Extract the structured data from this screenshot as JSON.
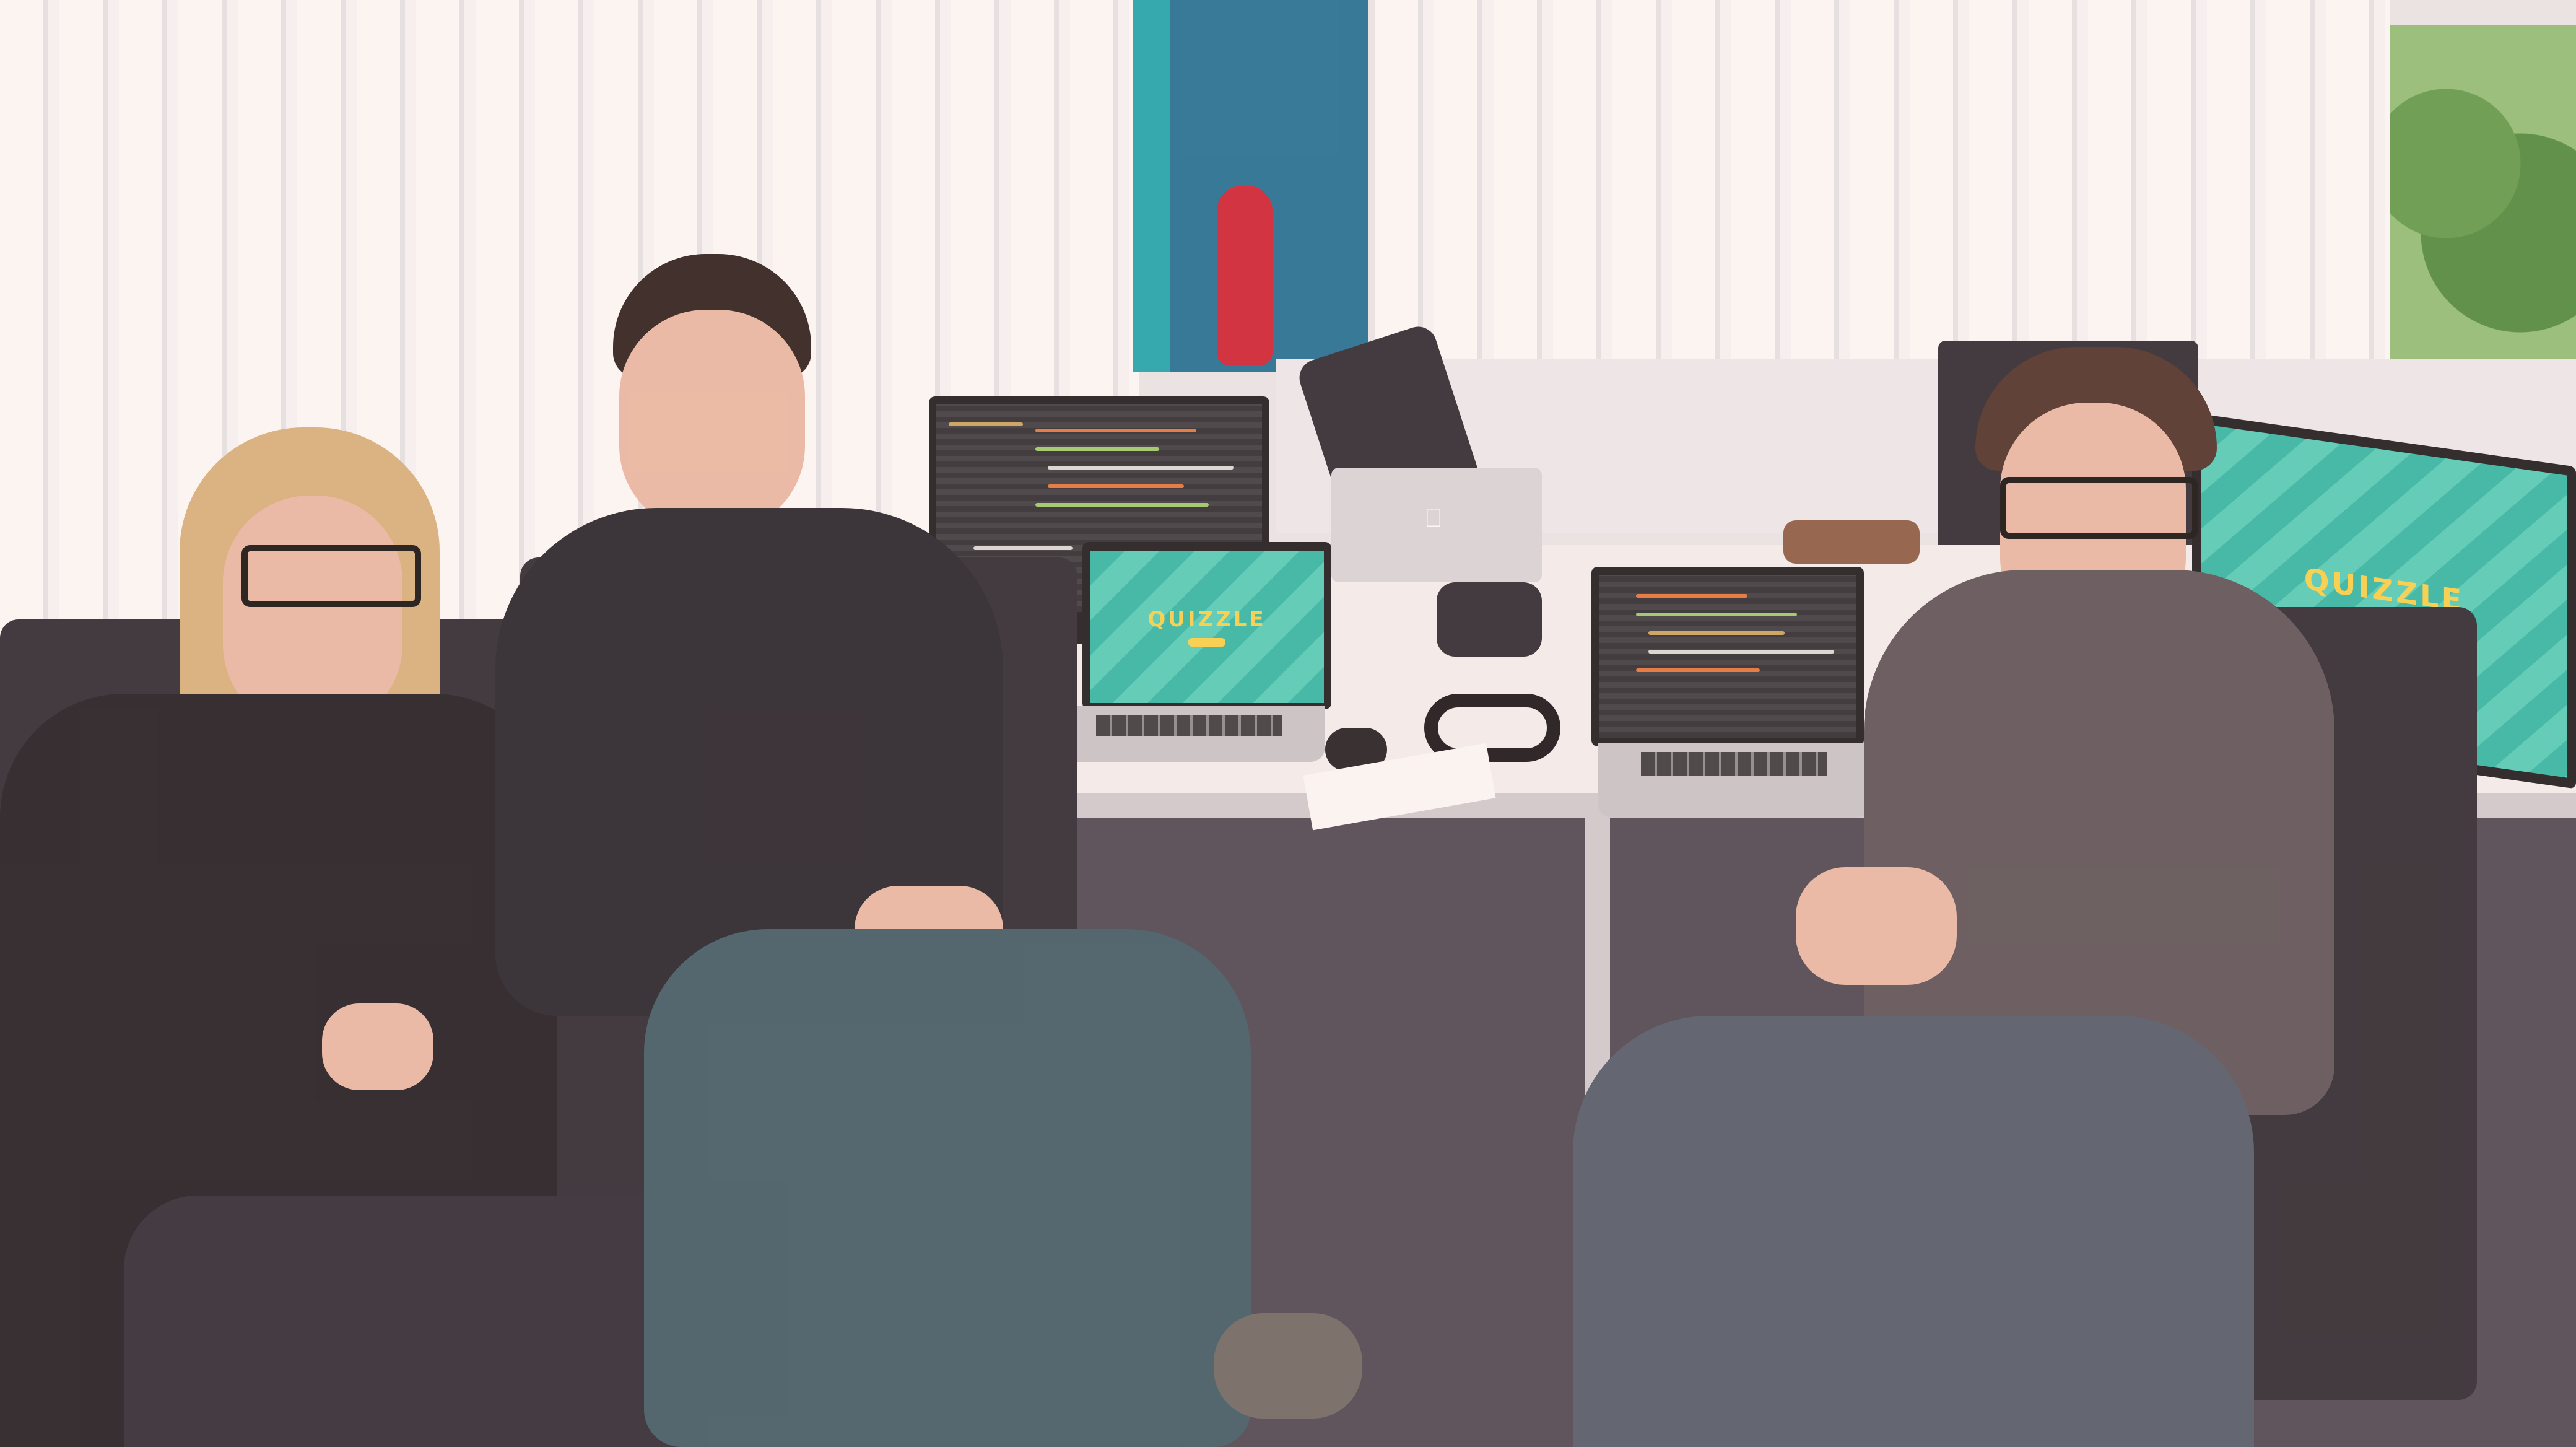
{
  "scene": {
    "description_label": "",
    "screens": {
      "laptop_center_brand": "QUIZZLE",
      "right_monitor_brand": "QUIZZLE"
    }
  },
  "icons": [
    "fire-extinguisher-icon",
    "apple-logo-icon"
  ],
  "colors": {
    "accent_teal": "#2fb8a6",
    "logo_yellow": "#f7d247",
    "wall_blue": "#1d6f95"
  }
}
